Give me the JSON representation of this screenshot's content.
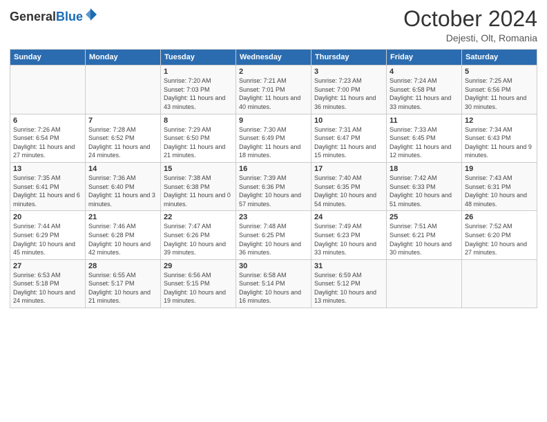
{
  "header": {
    "logo": {
      "general": "General",
      "blue": "Blue"
    },
    "title": "October 2024",
    "location": "Dejesti, Olt, Romania"
  },
  "weekdays": [
    "Sunday",
    "Monday",
    "Tuesday",
    "Wednesday",
    "Thursday",
    "Friday",
    "Saturday"
  ],
  "weeks": [
    [
      {
        "day": "",
        "sunrise": "",
        "sunset": "",
        "daylight": ""
      },
      {
        "day": "",
        "sunrise": "",
        "sunset": "",
        "daylight": ""
      },
      {
        "day": "1",
        "sunrise": "Sunrise: 7:20 AM",
        "sunset": "Sunset: 7:03 PM",
        "daylight": "Daylight: 11 hours and 43 minutes."
      },
      {
        "day": "2",
        "sunrise": "Sunrise: 7:21 AM",
        "sunset": "Sunset: 7:01 PM",
        "daylight": "Daylight: 11 hours and 40 minutes."
      },
      {
        "day": "3",
        "sunrise": "Sunrise: 7:23 AM",
        "sunset": "Sunset: 7:00 PM",
        "daylight": "Daylight: 11 hours and 36 minutes."
      },
      {
        "day": "4",
        "sunrise": "Sunrise: 7:24 AM",
        "sunset": "Sunset: 6:58 PM",
        "daylight": "Daylight: 11 hours and 33 minutes."
      },
      {
        "day": "5",
        "sunrise": "Sunrise: 7:25 AM",
        "sunset": "Sunset: 6:56 PM",
        "daylight": "Daylight: 11 hours and 30 minutes."
      }
    ],
    [
      {
        "day": "6",
        "sunrise": "Sunrise: 7:26 AM",
        "sunset": "Sunset: 6:54 PM",
        "daylight": "Daylight: 11 hours and 27 minutes."
      },
      {
        "day": "7",
        "sunrise": "Sunrise: 7:28 AM",
        "sunset": "Sunset: 6:52 PM",
        "daylight": "Daylight: 11 hours and 24 minutes."
      },
      {
        "day": "8",
        "sunrise": "Sunrise: 7:29 AM",
        "sunset": "Sunset: 6:50 PM",
        "daylight": "Daylight: 11 hours and 21 minutes."
      },
      {
        "day": "9",
        "sunrise": "Sunrise: 7:30 AM",
        "sunset": "Sunset: 6:49 PM",
        "daylight": "Daylight: 11 hours and 18 minutes."
      },
      {
        "day": "10",
        "sunrise": "Sunrise: 7:31 AM",
        "sunset": "Sunset: 6:47 PM",
        "daylight": "Daylight: 11 hours and 15 minutes."
      },
      {
        "day": "11",
        "sunrise": "Sunrise: 7:33 AM",
        "sunset": "Sunset: 6:45 PM",
        "daylight": "Daylight: 11 hours and 12 minutes."
      },
      {
        "day": "12",
        "sunrise": "Sunrise: 7:34 AM",
        "sunset": "Sunset: 6:43 PM",
        "daylight": "Daylight: 11 hours and 9 minutes."
      }
    ],
    [
      {
        "day": "13",
        "sunrise": "Sunrise: 7:35 AM",
        "sunset": "Sunset: 6:41 PM",
        "daylight": "Daylight: 11 hours and 6 minutes."
      },
      {
        "day": "14",
        "sunrise": "Sunrise: 7:36 AM",
        "sunset": "Sunset: 6:40 PM",
        "daylight": "Daylight: 11 hours and 3 minutes."
      },
      {
        "day": "15",
        "sunrise": "Sunrise: 7:38 AM",
        "sunset": "Sunset: 6:38 PM",
        "daylight": "Daylight: 11 hours and 0 minutes."
      },
      {
        "day": "16",
        "sunrise": "Sunrise: 7:39 AM",
        "sunset": "Sunset: 6:36 PM",
        "daylight": "Daylight: 10 hours and 57 minutes."
      },
      {
        "day": "17",
        "sunrise": "Sunrise: 7:40 AM",
        "sunset": "Sunset: 6:35 PM",
        "daylight": "Daylight: 10 hours and 54 minutes."
      },
      {
        "day": "18",
        "sunrise": "Sunrise: 7:42 AM",
        "sunset": "Sunset: 6:33 PM",
        "daylight": "Daylight: 10 hours and 51 minutes."
      },
      {
        "day": "19",
        "sunrise": "Sunrise: 7:43 AM",
        "sunset": "Sunset: 6:31 PM",
        "daylight": "Daylight: 10 hours and 48 minutes."
      }
    ],
    [
      {
        "day": "20",
        "sunrise": "Sunrise: 7:44 AM",
        "sunset": "Sunset: 6:29 PM",
        "daylight": "Daylight: 10 hours and 45 minutes."
      },
      {
        "day": "21",
        "sunrise": "Sunrise: 7:46 AM",
        "sunset": "Sunset: 6:28 PM",
        "daylight": "Daylight: 10 hours and 42 minutes."
      },
      {
        "day": "22",
        "sunrise": "Sunrise: 7:47 AM",
        "sunset": "Sunset: 6:26 PM",
        "daylight": "Daylight: 10 hours and 39 minutes."
      },
      {
        "day": "23",
        "sunrise": "Sunrise: 7:48 AM",
        "sunset": "Sunset: 6:25 PM",
        "daylight": "Daylight: 10 hours and 36 minutes."
      },
      {
        "day": "24",
        "sunrise": "Sunrise: 7:49 AM",
        "sunset": "Sunset: 6:23 PM",
        "daylight": "Daylight: 10 hours and 33 minutes."
      },
      {
        "day": "25",
        "sunrise": "Sunrise: 7:51 AM",
        "sunset": "Sunset: 6:21 PM",
        "daylight": "Daylight: 10 hours and 30 minutes."
      },
      {
        "day": "26",
        "sunrise": "Sunrise: 7:52 AM",
        "sunset": "Sunset: 6:20 PM",
        "daylight": "Daylight: 10 hours and 27 minutes."
      }
    ],
    [
      {
        "day": "27",
        "sunrise": "Sunrise: 6:53 AM",
        "sunset": "Sunset: 5:18 PM",
        "daylight": "Daylight: 10 hours and 24 minutes."
      },
      {
        "day": "28",
        "sunrise": "Sunrise: 6:55 AM",
        "sunset": "Sunset: 5:17 PM",
        "daylight": "Daylight: 10 hours and 21 minutes."
      },
      {
        "day": "29",
        "sunrise": "Sunrise: 6:56 AM",
        "sunset": "Sunset: 5:15 PM",
        "daylight": "Daylight: 10 hours and 19 minutes."
      },
      {
        "day": "30",
        "sunrise": "Sunrise: 6:58 AM",
        "sunset": "Sunset: 5:14 PM",
        "daylight": "Daylight: 10 hours and 16 minutes."
      },
      {
        "day": "31",
        "sunrise": "Sunrise: 6:59 AM",
        "sunset": "Sunset: 5:12 PM",
        "daylight": "Daylight: 10 hours and 13 minutes."
      },
      {
        "day": "",
        "sunrise": "",
        "sunset": "",
        "daylight": ""
      },
      {
        "day": "",
        "sunrise": "",
        "sunset": "",
        "daylight": ""
      }
    ]
  ]
}
